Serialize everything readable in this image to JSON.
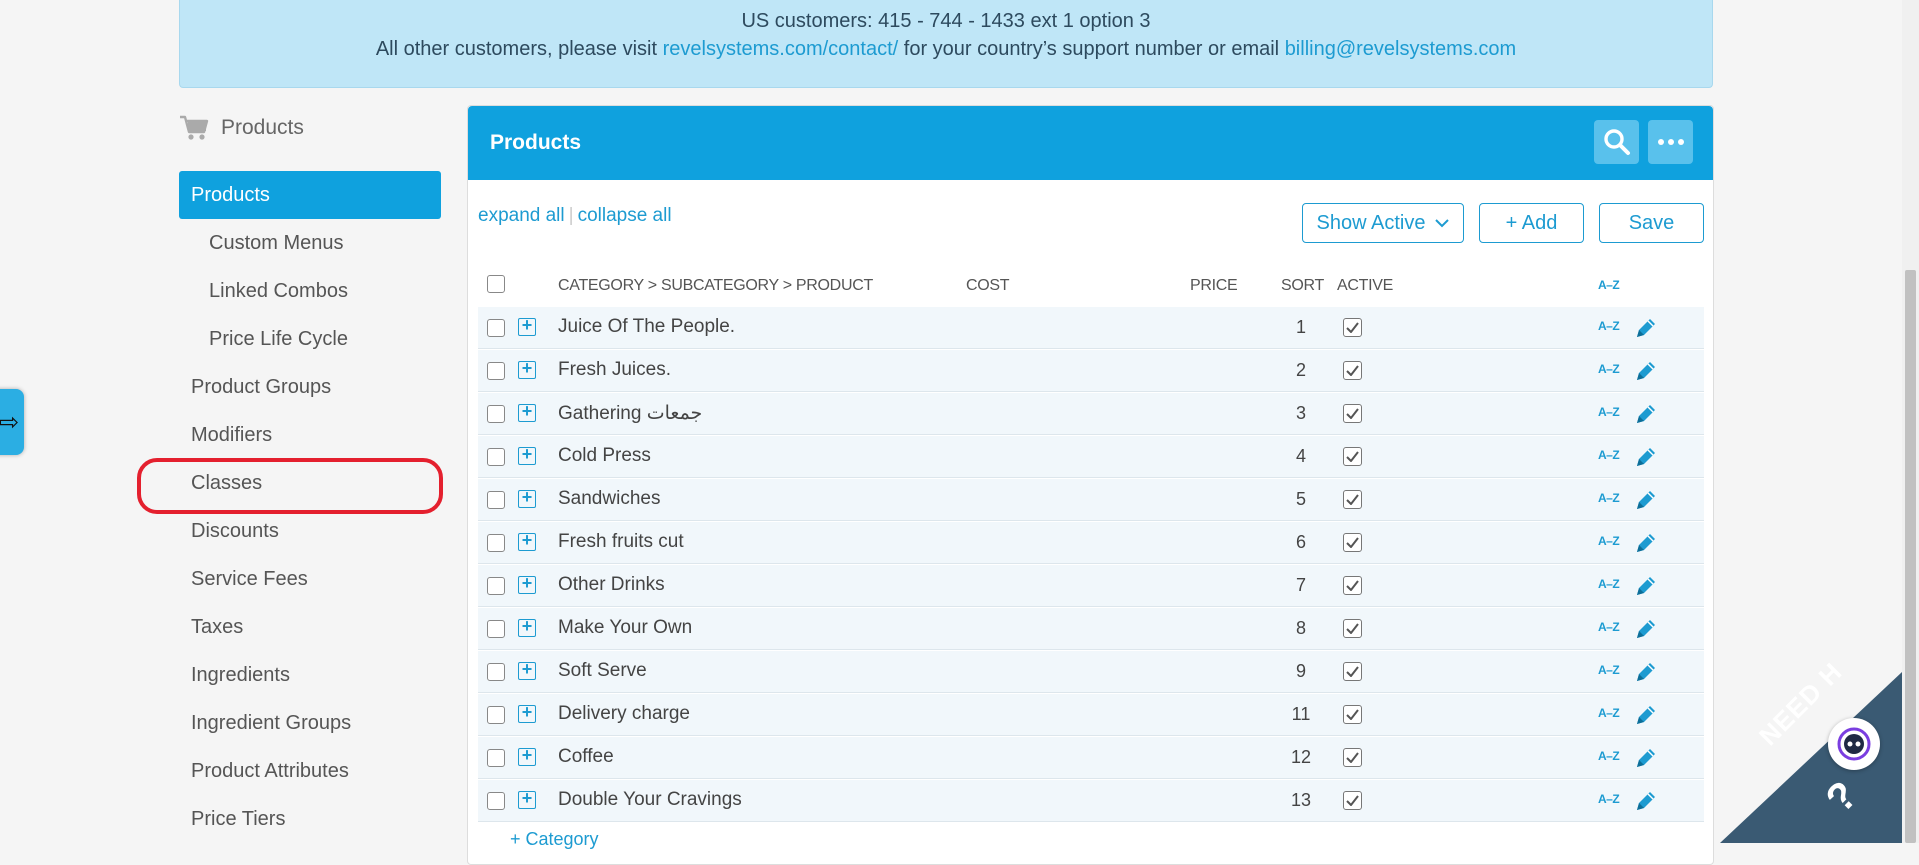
{
  "banner": {
    "line1": "US customers: 415 - 744 - 1433 ext 1 option 3",
    "line2_prefix": "All other customers, please visit ",
    "line2_link": "revelsystems.com/contact/",
    "line2_mid": " for your country’s support number or email ",
    "line2_email": "billing@revelsystems.com"
  },
  "nav": {
    "header": "Products",
    "active": "Products",
    "items": [
      {
        "label": "Custom Menus"
      },
      {
        "label": "Linked Combos"
      },
      {
        "label": "Price Life Cycle"
      },
      {
        "label": "Product Groups"
      },
      {
        "label": "Modifiers"
      },
      {
        "label": "Classes"
      },
      {
        "label": "Discounts"
      },
      {
        "label": "Service Fees"
      },
      {
        "label": "Taxes"
      },
      {
        "label": "Ingredients"
      },
      {
        "label": "Ingredient Groups"
      },
      {
        "label": "Product Attributes"
      },
      {
        "label": "Price Tiers"
      }
    ]
  },
  "side_toggle_glyph": "⇨",
  "panel": {
    "title": "Products",
    "expand_all": "expand all",
    "separator": "|",
    "collapse_all": "collapse all",
    "show_active": "Show Active",
    "add": "+ Add",
    "save": "Save",
    "add_category": "+ Category"
  },
  "table": {
    "headers": {
      "category": "CATEGORY > SUBCATEGORY > PRODUCT",
      "cost": "COST",
      "price": "PRICE",
      "sort": "SORT",
      "active": "ACTIVE",
      "az": "A–Z"
    },
    "rows": [
      {
        "name": "Juice Of The People.",
        "sort": "1",
        "active": true
      },
      {
        "name": "Fresh Juices.",
        "sort": "2",
        "active": true
      },
      {
        "name": "Gathering جمعات",
        "sort": "3",
        "active": true
      },
      {
        "name": "Cold Press",
        "sort": "4",
        "active": true
      },
      {
        "name": "Sandwiches",
        "sort": "5",
        "active": true
      },
      {
        "name": "Fresh fruits cut",
        "sort": "6",
        "active": true
      },
      {
        "name": "Other Drinks",
        "sort": "7",
        "active": true
      },
      {
        "name": "Make Your Own",
        "sort": "8",
        "active": true
      },
      {
        "name": "Soft Serve",
        "sort": "9",
        "active": true
      },
      {
        "name": "Delivery charge",
        "sort": "11",
        "active": true
      },
      {
        "name": "Coffee",
        "sort": "12",
        "active": true
      },
      {
        "name": "Double Your Cravings",
        "sort": "13",
        "active": true
      }
    ],
    "row_az": "A–Z"
  },
  "help": {
    "text": "NEED H",
    "question": "?"
  },
  "colors": {
    "accent": "#0fa1de",
    "banner_bg": "#bfe6f7",
    "highlight": "#e4202e",
    "help_corner": "#3a5a73"
  }
}
